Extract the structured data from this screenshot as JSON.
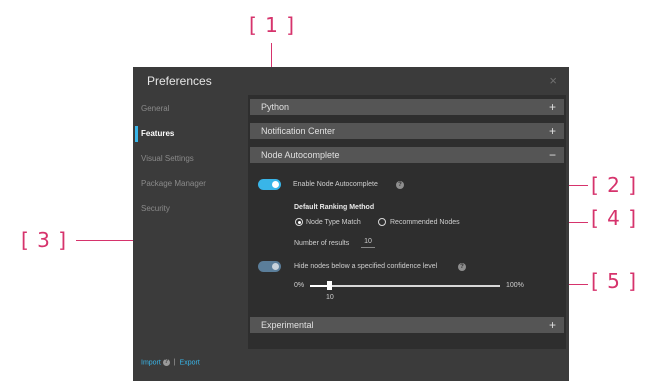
{
  "callouts": {
    "c1": "[ 1 ]",
    "c2": "[ 2 ]",
    "c3": "[ 3 ]",
    "c4": "[ 4 ]",
    "c5": "[ 5 ]"
  },
  "dialog": {
    "title": "Preferences",
    "close_glyph": "×"
  },
  "sidebar": {
    "items": [
      {
        "label": "General"
      },
      {
        "label": "Features"
      },
      {
        "label": "Visual Settings"
      },
      {
        "label": "Package Manager"
      },
      {
        "label": "Security"
      }
    ],
    "active_index": 1
  },
  "footer": {
    "import_label": "Import",
    "separator": "|",
    "export_label": "Export",
    "help_glyph": "?"
  },
  "sections": [
    {
      "label": "Python",
      "toggle": "+"
    },
    {
      "label": "Notification Center",
      "toggle": "+"
    },
    {
      "label": "Node Autocomplete",
      "toggle": "−"
    },
    {
      "label": "Experimental",
      "toggle": "+"
    }
  ],
  "autocomplete": {
    "enable_label": "Enable Node Autocomplete",
    "enable_on": true,
    "ranking_title": "Default Ranking Method",
    "option_node_type": "Node Type Match",
    "option_recommended": "Recommended Nodes",
    "selected_option": "Node Type Match",
    "results_label": "Number of results",
    "results_value": "10",
    "hide_label": "Hide nodes below a specified confidence level",
    "hide_on": true,
    "slider_min_label": "0%",
    "slider_max_label": "100%",
    "slider_value_label": "10",
    "slider_value": 0.1,
    "help_glyph": "?"
  }
}
